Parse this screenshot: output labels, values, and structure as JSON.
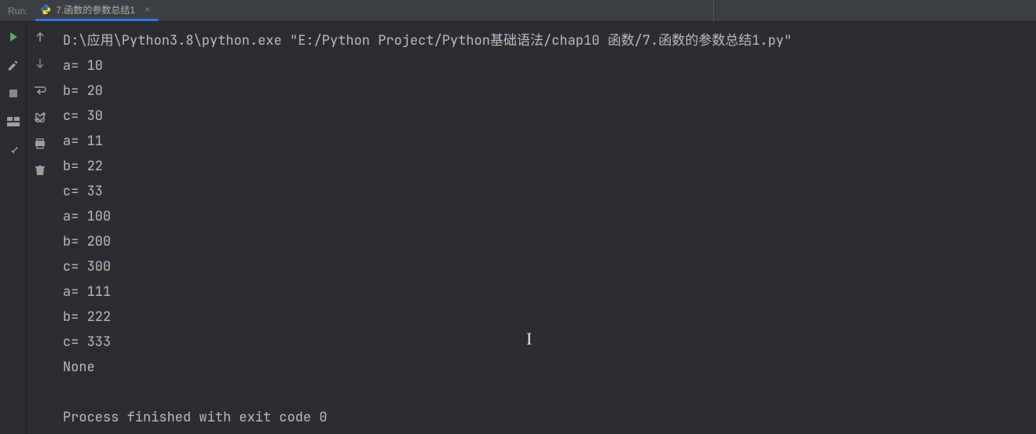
{
  "header": {
    "run_label": "Run:",
    "tab_label": "7.函数的参数总结1"
  },
  "console": {
    "lines": [
      "D:\\应用\\Python3.8\\python.exe \"E:/Python Project/Python基础语法/chap10 函数/7.函数的参数总结1.py\"",
      "a= 10",
      "b= 20",
      "c= 30",
      "a= 11",
      "b= 22",
      "c= 33",
      "a= 100",
      "b= 200",
      "c= 300",
      "a= 111",
      "b= 222",
      "c= 333",
      "None",
      "",
      "Process finished with exit code 0"
    ]
  },
  "icons": {
    "run": "run",
    "wrench": "wrench",
    "stop": "stop",
    "layout": "layout",
    "pin": "pin",
    "up": "up",
    "down": "down",
    "wrap": "wrap",
    "scroll": "scroll",
    "print": "print",
    "trash": "trash"
  }
}
